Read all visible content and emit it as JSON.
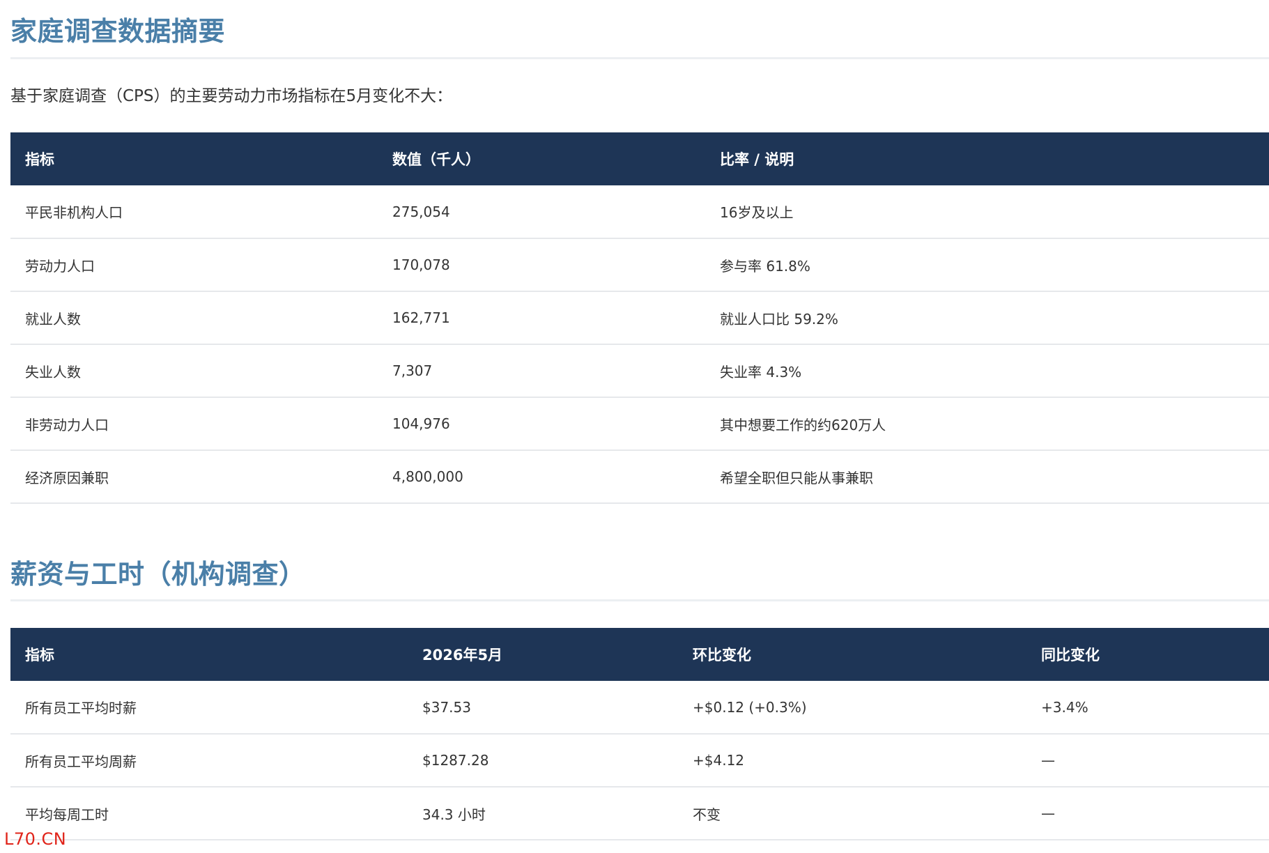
{
  "household": {
    "title": "家庭调查数据摘要",
    "intro": "基于家庭调查（CPS）的主要劳动力市场指标在5月变化不大：",
    "columns": [
      "指标",
      "数值（千人）",
      "比率 / 说明"
    ],
    "rows": [
      [
        "平民非机构人口",
        "275,054",
        "16岁及以上"
      ],
      [
        "劳动力人口",
        "170,078",
        "参与率 61.8%"
      ],
      [
        "就业人数",
        "162,771",
        "就业人口比 59.2%"
      ],
      [
        "失业人数",
        "7,307",
        "失业率 4.3%"
      ],
      [
        "非劳动力人口",
        "104,976",
        "其中想要工作的约620万人"
      ],
      [
        "经济原因兼职",
        "4,800,000",
        "希望全职但只能从事兼职"
      ]
    ]
  },
  "wages": {
    "title": "薪资与工时（机构调查）",
    "columns": [
      "指标",
      "2026年5月",
      "环比变化",
      "同比变化"
    ],
    "rows": [
      [
        "所有员工平均时薪",
        "$37.53",
        "+$0.12 (+0.3%)",
        "+3.4%"
      ],
      [
        "所有员工平均周薪",
        "$1287.28",
        "+$4.12",
        "—"
      ],
      [
        "平均每周工时",
        "34.3 小时",
        "不变",
        "—"
      ]
    ]
  },
  "watermark": "L70.CN",
  "colors": {
    "heading": "#4a7fa8",
    "table_header_bg": "#1e3556",
    "watermark": "#e0241a"
  }
}
